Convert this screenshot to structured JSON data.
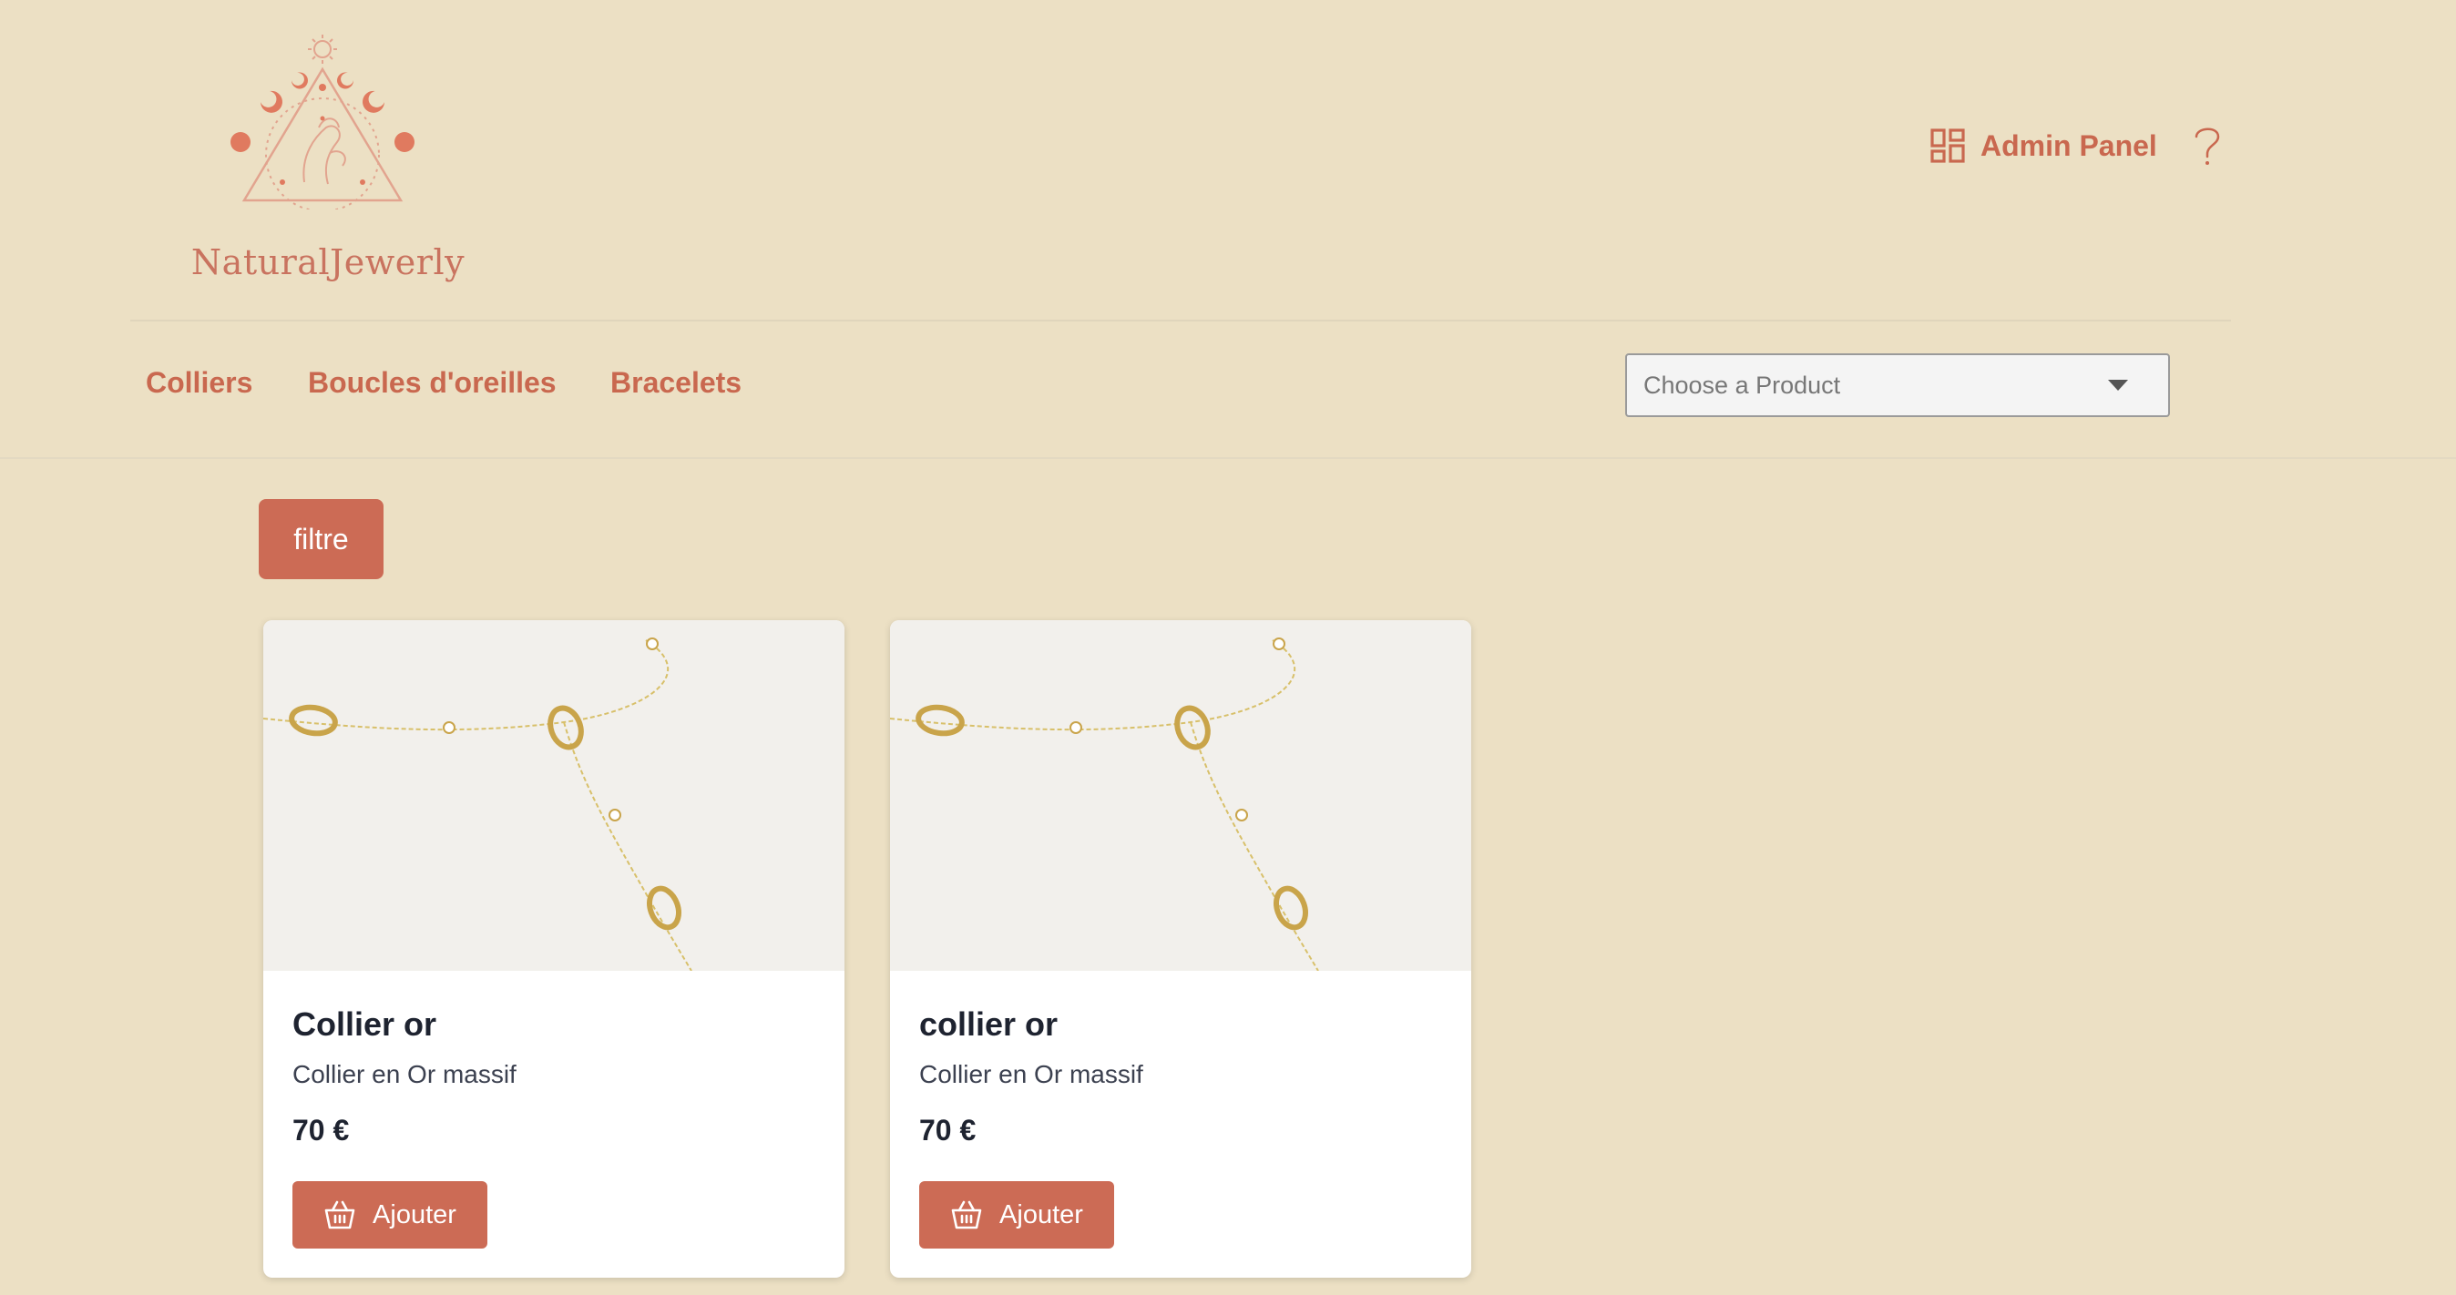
{
  "header": {
    "brand_name": "NaturalJewerly",
    "admin_label": "Admin Panel"
  },
  "nav": {
    "items": [
      {
        "label": "Colliers"
      },
      {
        "label": "Boucles d'oreilles"
      },
      {
        "label": "Bracelets"
      }
    ],
    "select_placeholder": "Choose a Product"
  },
  "filter_label": "filtre",
  "products": [
    {
      "title": "Collier or",
      "description": "Collier en Or massif",
      "price": "70 €",
      "button_label": "Ajouter"
    },
    {
      "title": "collier or",
      "description": "Collier en Or massif",
      "price": "70 €",
      "button_label": "Ajouter"
    }
  ],
  "colors": {
    "background": "#ece0c4",
    "accent": "#cc6b55",
    "text_dark": "#1e2330"
  },
  "icons": {
    "admin": "dashboard-icon",
    "help": "question-mark-icon",
    "basket": "basket-icon",
    "dropdown": "chevron-down-icon"
  }
}
